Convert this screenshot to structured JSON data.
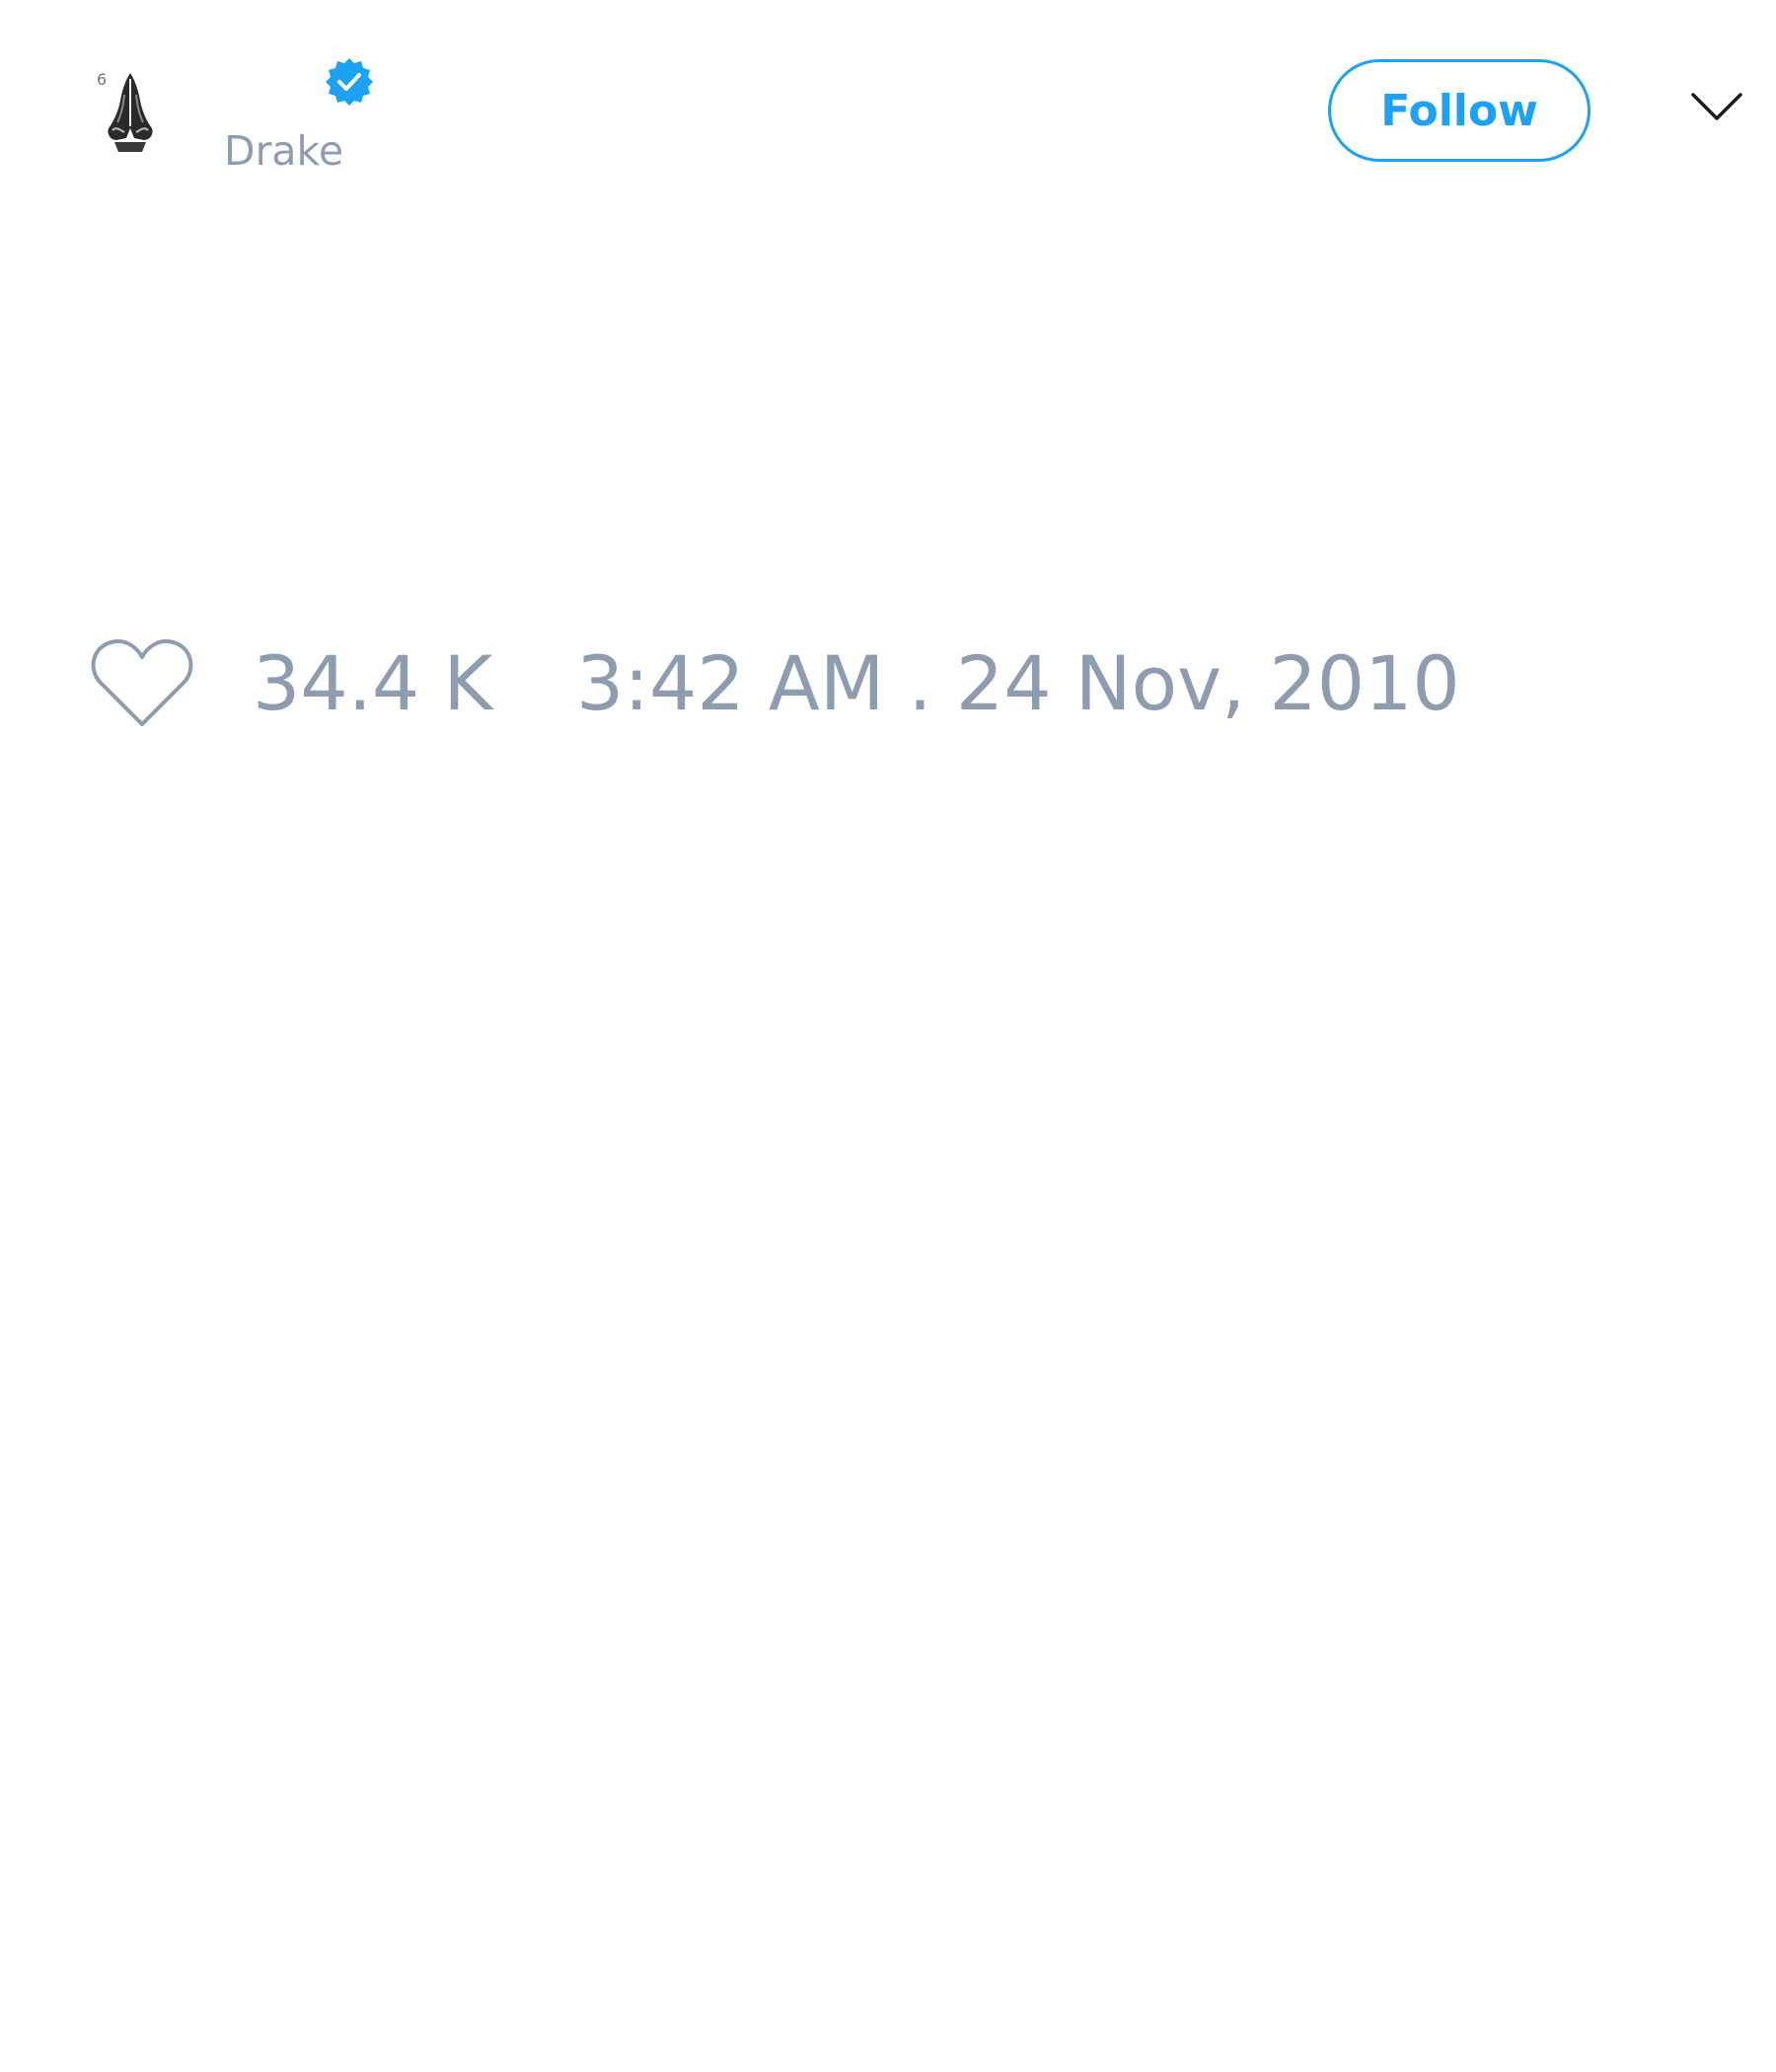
{
  "author": {
    "display_name": "Drake",
    "verified": true,
    "avatar_icon": "praying-hands-icon"
  },
  "header": {
    "follow_label": "Follow",
    "menu_icon": "chevron-down-icon"
  },
  "stats": {
    "like_icon": "heart-icon",
    "likes": "34.4 K",
    "timestamp": "3:42 AM . 24 Nov, 2010"
  },
  "colors": {
    "accent": "#1da1f2",
    "muted_text": "#8e9cb0",
    "background": "#ffffff"
  }
}
